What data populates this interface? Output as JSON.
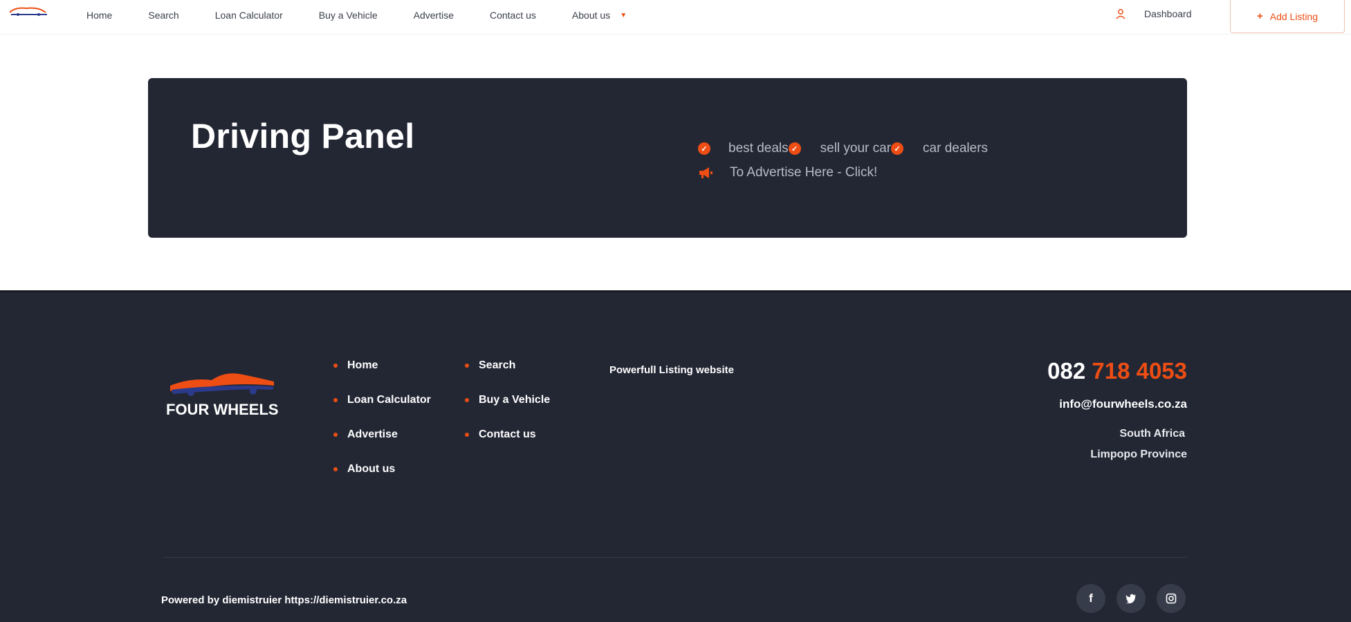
{
  "header": {
    "nav": [
      {
        "label": "Home"
      },
      {
        "label": "Search"
      },
      {
        "label": "Loan Calculator"
      },
      {
        "label": "Buy a Vehicle"
      },
      {
        "label": "Advertise"
      },
      {
        "label": "Contact us"
      },
      {
        "label": "About us"
      }
    ],
    "dashboard_label": "Dashboard",
    "add_listing_label": "Add Listing"
  },
  "banner": {
    "title": "Driving Panel",
    "features": [
      "best deals",
      "sell your car",
      "car dealers"
    ],
    "advertise_text": "To Advertise Here - Click!"
  },
  "footer": {
    "links_col1": [
      "Home",
      "Loan Calculator",
      "Advertise",
      "About us"
    ],
    "links_col2": [
      "Search",
      "Buy a Vehicle",
      "Contact us"
    ],
    "tagline": "Powerfull Listing website",
    "phone_prefix": "082",
    "phone_rest": "718 4053",
    "email": "info@fourwheels.co.za",
    "address_line1": "South Africa",
    "address_line2": "Limpopo Province",
    "powered_by": "Powered by diemistruier https://diemistruier.co.za",
    "logo_text": "FOUR WHEELS",
    "social": [
      "facebook-icon",
      "twitter-icon",
      "instagram-icon"
    ]
  },
  "colors": {
    "accent": "#ee4d14",
    "dark": "#232734"
  }
}
